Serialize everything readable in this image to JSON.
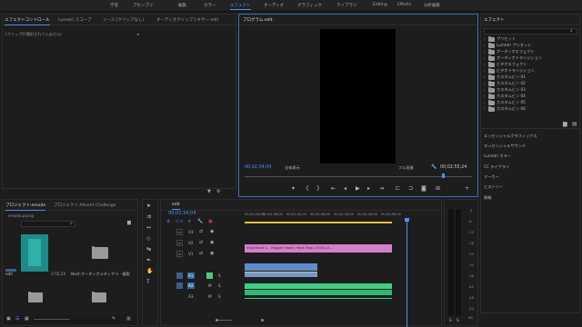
{
  "workspaces": {
    "items": [
      "学習",
      "アセンブリ",
      "編集",
      "カラー",
      "エフェクト",
      "オーディオ",
      "グラフィック",
      "ライブラリ",
      "Editing",
      "Effects",
      "分析編集"
    ],
    "active": "エフェクト"
  },
  "source_panel": {
    "tabs": [
      "エフェクトコントロール",
      "Lumetri スコープ",
      "ソース:(クリップなし)",
      "オーディオクリップミキサー:edit"
    ],
    "empty_message": "(クリップが選択されていません)"
  },
  "program_monitor": {
    "tab": "プログラム:edit",
    "timecode_left": "00;02;34;04",
    "fit_label": "全体表示",
    "quality_label": "フル画質",
    "timecode_right": "00;02;55;24"
  },
  "effects_panel": {
    "title": "エフェクト",
    "folders": [
      "プリセット",
      "Lumetri プリセット",
      "オーディオエフェクト",
      "オーディオトランジション",
      "ビデオエフェクト",
      "ビデオトランジション",
      "カスタムビン 01",
      "カスタムビン 02",
      "カスタムビン 03",
      "カスタムビン 04",
      "カスタムビン 05",
      "カスタムビン 06"
    ],
    "sections": [
      "エッセンシャルグラフィックス",
      "エッセンシャルサウンド",
      "Lumetri カラー",
      "CC ライブラリ",
      "マーカー",
      "ヒストリー",
      "情報"
    ]
  },
  "project_panel": {
    "tabs": [
      "プロジェクト:emoda",
      "プロジェクト:Advent Challenge"
    ],
    "path": "emoda.prproj",
    "search_placeholder": "",
    "items": [
      {
        "name": "edit",
        "meta": "2:55;24"
      },
      {
        "name": "Nest-オーディオメディア-1 - 複製",
        "meta": ""
      }
    ]
  },
  "timeline": {
    "tab": "edit",
    "timecode": "00;02;34;04",
    "ruler": [
      "00;01;20;00",
      "00;01;36;00",
      "00;01;52;00",
      "00;02;08;00",
      "00;02;24;00",
      "00;02;40;00",
      "00;02;56;00"
    ],
    "video_tracks": [
      "V3",
      "V2",
      "V1"
    ],
    "audio_tracks": [
      "A1",
      "A2",
      "A3"
    ],
    "clip_label": "Vlog Shoot 1 - Vlogger Shoot / Nest Vlog / 2024-10 ..."
  },
  "audio_meter": {
    "ticks": [
      "0",
      "-6",
      "-12",
      "-18",
      "-24",
      "-30",
      "-36",
      "-42",
      "-48",
      "-54",
      "dB"
    ],
    "channels": [
      "S",
      "S"
    ]
  },
  "colors": {
    "accent": "#4f8ff0",
    "clip_pink": "#d67fc6",
    "clip_blue": "#5a8ed0",
    "clip_green": "#3fcf85",
    "clip_yellow": "#e8c428"
  }
}
